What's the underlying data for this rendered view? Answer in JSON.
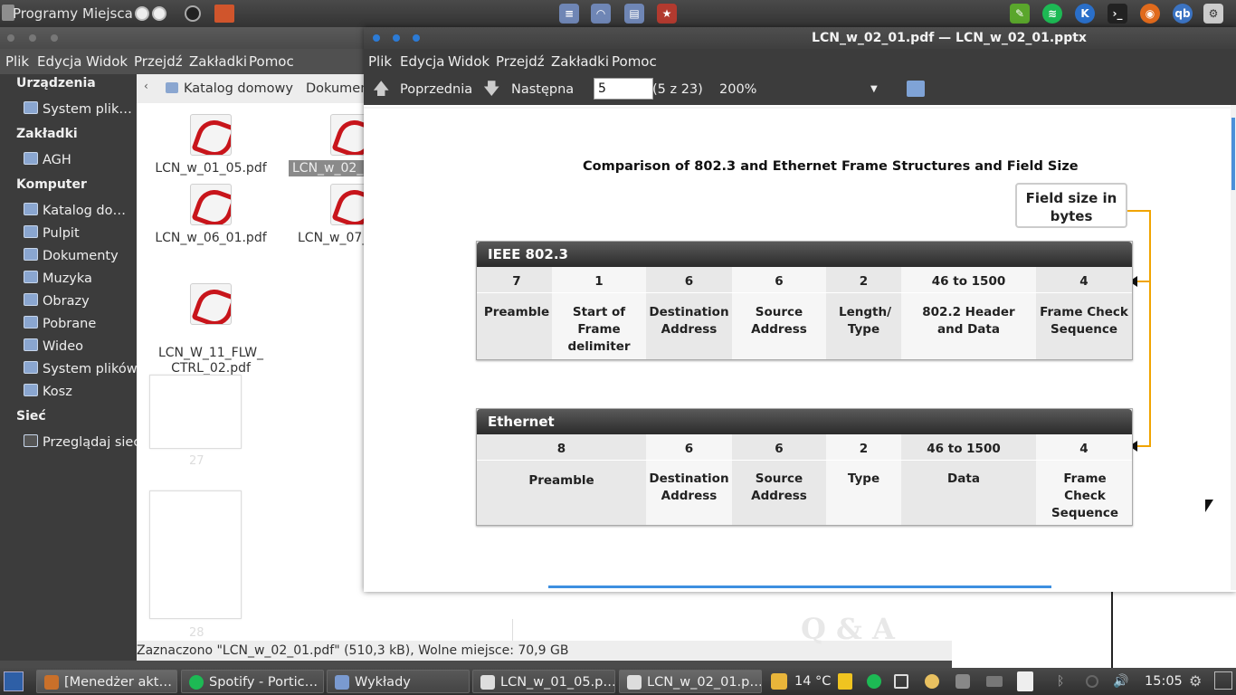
{
  "top_panel": {
    "menus": [
      "Programy",
      "Miejsca"
    ],
    "launchers": [
      "files-icon",
      "wifi-icon",
      "document-icon",
      "bookmark-icon"
    ],
    "tray": [
      "notes-icon",
      "spotify-icon",
      "kopete-icon",
      "terminal-icon",
      "firefox-icon",
      "qbittorrent-icon",
      "settings-icon"
    ],
    "tray_labels": {
      "kopete": "K",
      "qb": "qb"
    }
  },
  "file_manager": {
    "menu": [
      "Plik",
      "Edycja",
      "Widok",
      "Przejdź",
      "Zakładki",
      "Pomoc"
    ],
    "path": [
      "Katalog domowy",
      "Dokumen"
    ],
    "sidebar": {
      "devices_heading": "Urządzenia",
      "devices": [
        "System plik…"
      ],
      "bookmarks_heading": "Zakładki",
      "bookmarks": [
        "AGH"
      ],
      "computer_heading": "Komputer",
      "computer": [
        "Katalog do…",
        "Pulpit",
        "Dokumenty",
        "Muzyka",
        "Obrazy",
        "Pobrane",
        "Wideo",
        "System plików",
        "Kosz"
      ],
      "network_heading": "Sieć",
      "network": [
        "Przeglądaj sieć"
      ]
    },
    "files": [
      {
        "name": "LCN_w_01_05.pdf"
      },
      {
        "name": "LCN_w_02_"
      },
      {
        "name": "LCN_w_06_01.pdf"
      },
      {
        "name": "LCN_w_07_"
      },
      {
        "name": "LCN_W_11_FLW_\nCTRL_02.pdf"
      }
    ],
    "thumb_numbers": [
      "27",
      "28"
    ],
    "status": "Zaznaczono \"LCN_w_02_01.pdf\" (510,3 kB), Wolne miejsce: 70,9 GB",
    "watermark": "Q & A"
  },
  "viewer": {
    "title": "LCN_w_02_01.pdf — LCN_w_02_01.pptx",
    "menu": [
      "Plik",
      "Edycja",
      "Widok",
      "Przejdź",
      "Zakładki",
      "Pomoc"
    ],
    "prev_label": "Poprzednia",
    "next_label": "Następna",
    "page_value": "5",
    "page_count": "(5 z 23)",
    "zoom": "200%",
    "slide": {
      "title": "Comparison of 802.3 and Ethernet Frame Structures and Field Size",
      "field_size_label": "Field size in bytes",
      "ieee": {
        "heading": "IEEE 802.3",
        "sizes": [
          "7",
          "1",
          "6",
          "6",
          "2",
          "46 to 1500",
          "4"
        ],
        "fields": [
          "Preamble",
          "Start of Frame delimiter",
          "Destination Address",
          "Source Address",
          "Length/ Type",
          "802.2 Header and Data",
          "Frame Check Sequence"
        ]
      },
      "ethernet": {
        "heading": "Ethernet",
        "sizes": [
          "8",
          "6",
          "6",
          "2",
          "46 to 1500",
          "4"
        ],
        "fields": [
          "Preamble",
          "Destination Address",
          "Source Address",
          "Type",
          "Data",
          "Frame Check Sequence"
        ]
      }
    }
  },
  "taskbar": {
    "tasks": [
      {
        "label": "[Menedżer akt…",
        "color": "#c9702a"
      },
      {
        "label": "Spotify - Portic…",
        "color": "#1db954"
      },
      {
        "label": "Wykłady",
        "color": "#7a9ad0"
      },
      {
        "label": "LCN_w_01_05.p…",
        "color": "#dddddd"
      },
      {
        "label": "LCN_w_02_01.p…",
        "color": "#dddddd"
      }
    ],
    "weather": "14 °C",
    "clock": "15:05"
  }
}
